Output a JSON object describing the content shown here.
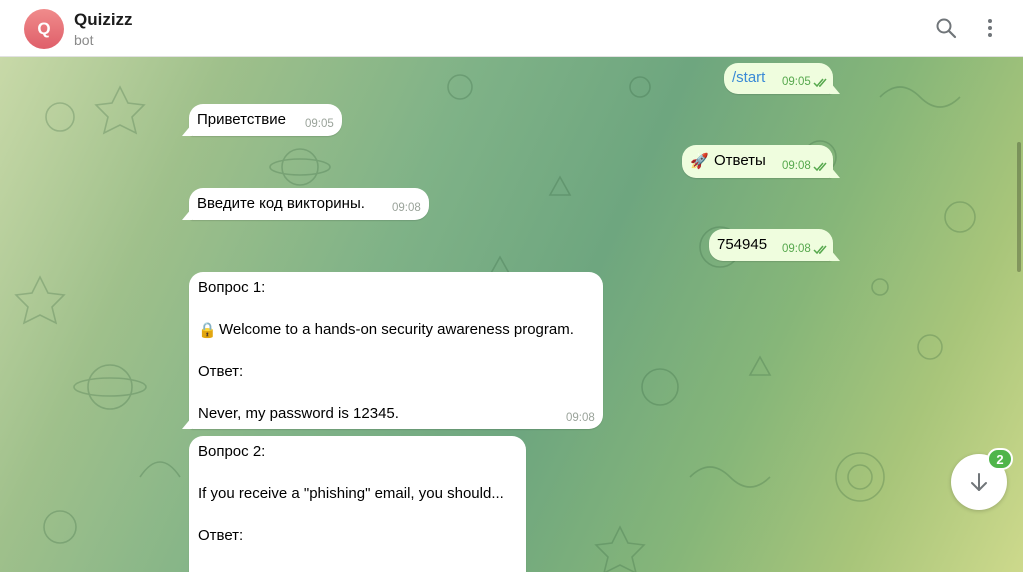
{
  "header": {
    "avatar_letter": "Q",
    "title": "Quizizz",
    "subtitle": "bot",
    "search_icon": "search-icon",
    "menu_icon": "more-vertical-icon"
  },
  "messages": [
    {
      "direction": "out",
      "text": "/start",
      "time": "09:05",
      "read": true
    },
    {
      "direction": "in",
      "text": "Приветствие",
      "time": "09:05"
    },
    {
      "direction": "out",
      "emoji": "🚀",
      "text": "Ответы",
      "time": "09:08",
      "read": true
    },
    {
      "direction": "in",
      "text": "Введите код викторины.",
      "time": "09:08"
    },
    {
      "direction": "out",
      "text": "754945",
      "time": "09:08",
      "read": true
    },
    {
      "direction": "in",
      "question_label": "Вопрос 1:",
      "question_icon": "🔒",
      "question_text": "Welcome to a hands-on security awareness program.",
      "answer_label": "Ответ:",
      "answer_text": "Never, my password is 12345.",
      "time": "09:08"
    },
    {
      "direction": "in",
      "question_label": "Вопрос 2:",
      "question_text": "If you receive a \"phishing\" email, you should...",
      "answer_label": "Ответ:"
    }
  ],
  "scroll_down": {
    "icon": "arrow-down-icon",
    "unread_count": "2"
  },
  "colors": {
    "outgoing_bubble": "#effdde",
    "incoming_bubble": "#ffffff",
    "accent_green": "#4fb54a",
    "command_blue": "#3a8ad6"
  }
}
